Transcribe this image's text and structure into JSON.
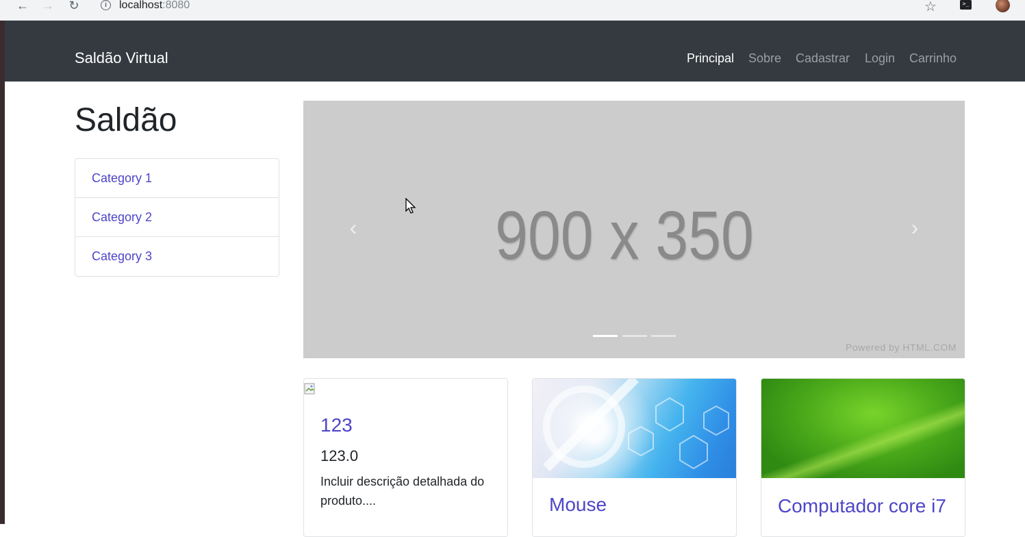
{
  "browser": {
    "url_host": "localhost",
    "url_port": ":8080",
    "icons": [
      "back-arrow-icon",
      "forward-arrow-icon",
      "reload-icon",
      "info-icon",
      "star-icon",
      "terminal-extension-icon",
      "profile-avatar"
    ]
  },
  "navbar": {
    "brand": "Saldão Virtual",
    "links": [
      {
        "label": "Principal",
        "active": true
      },
      {
        "label": "Sobre",
        "active": false
      },
      {
        "label": "Cadastrar",
        "active": false
      },
      {
        "label": "Login",
        "active": false
      },
      {
        "label": "Carrinho",
        "active": false
      }
    ]
  },
  "sidebar": {
    "title": "Saldão",
    "categories": [
      "Category 1",
      "Category 2",
      "Category 3"
    ]
  },
  "carousel": {
    "placeholder_text": "900 x 350",
    "powered_by": "Powered by HTML.COM",
    "slide_count": 3,
    "active_slide": 1
  },
  "products": [
    {
      "title": "123",
      "price": "123.0",
      "description": "Incluir descrição detalhada do produto....",
      "image": "broken-image-icon"
    },
    {
      "title": "Mouse",
      "image": "blue-abstract-image"
    },
    {
      "title": "Computador core i7",
      "image": "green-abstract-image"
    }
  ],
  "colors": {
    "navbar_bg": "#343a40",
    "link_color": "#4e45c8",
    "carousel_bg": "#cccccc"
  }
}
